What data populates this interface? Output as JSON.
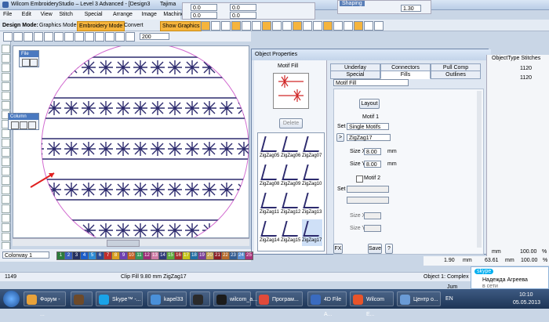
{
  "window_title": "Wilcom EmbroideryStudio – Level 3 Advanced - [Design3",
  "title_extra": "Tajima",
  "menu": [
    "File",
    "Edit",
    "View",
    "Stitch",
    "Special",
    "Arrange",
    "Image",
    "Machine",
    "Window"
  ],
  "toolbar": {
    "design_mode_label": "Design Mode:",
    "graphics_mode": "Graphics Mode",
    "embroidery_mode": "Embroidery Mode",
    "convert": "Convert",
    "show_graphics": "Show Graphics",
    "zoom_value": "200",
    "shaping_label": "Shaping",
    "value_130": "1.30",
    "coord_0a": "0.0",
    "coord_0b": "0.0",
    "coord_0c": "0.0",
    "coord_0d": "0.0"
  },
  "file_toolbar": {
    "title": "File"
  },
  "column_toolbar": {
    "title": "Column"
  },
  "colorway": {
    "label": "Colorway 1",
    "swatches": [
      "1",
      "2",
      "3",
      "4",
      "5",
      "6",
      "7",
      "8",
      "9",
      "10",
      "11",
      "12",
      "13",
      "14",
      "15",
      "16",
      "17",
      "18",
      "19",
      "20",
      "21",
      "22",
      "23",
      "24",
      "25"
    ],
    "colors": [
      "#2c7c3c",
      "#3a5fbf",
      "#25305f",
      "#1c5ec9",
      "#2d8cd6",
      "#2b4a92",
      "#c02d2d",
      "#d9a020",
      "#6f3fb2",
      "#c35f22",
      "#36965a",
      "#9d2b79",
      "#cf7aa6",
      "#2f3a7a",
      "#5caa39",
      "#a62d2d",
      "#c4c418",
      "#1f6fa5",
      "#7a3c98",
      "#c8a54e",
      "#8c1e26",
      "#b76a2a",
      "#345e94",
      "#5a8fd3",
      "#a8327a"
    ]
  },
  "dialog": {
    "title": "Object Properties",
    "tabs_row1": [
      "Underlay",
      "Connectors",
      "Pull Comp"
    ],
    "tabs_row2": [
      "Special",
      "Fills",
      "Outlines"
    ],
    "active_tab": "Fills",
    "fill_type": "Motif Fill",
    "preview_label": "Motif Fill",
    "delete": "Delete",
    "layout": "Layout",
    "motif1_label": "Motif 1",
    "set_label": "Set",
    "set_value": "Single Motifs",
    "motif_value": "ZigZag17",
    "size_x_label": "Size X",
    "size_x": "8.00",
    "size_y_label": "Size Y",
    "size_y": "8.00",
    "unit": "mm",
    "motif2_label": "Motif 2",
    "set2_label": "Set",
    "size_x2_label": "Size X",
    "size_y2_label": "Size Y",
    "fx": "FX",
    "save": "Save",
    "help": "?",
    "motifs": [
      "ZigZag05",
      "ZigZag06",
      "ZigZag07",
      "ZigZag08",
      "ZigZag09",
      "ZigZag10",
      "ZigZag11",
      "ZigZag12",
      "ZigZag13",
      "ZigZag14",
      "ZigZag15",
      "ZigZag17"
    ]
  },
  "right_panel": {
    "header": "ObjectType Stitches",
    "row1": "1120",
    "row2": "1120",
    "mm1": "mm",
    "pct1": "100.00",
    "pct1u": "%",
    "val_190": "1.90",
    "mm2": "mm",
    "val_6361": "63.61",
    "mm3": "mm",
    "pct2": "100.00",
    "pct2u": "%"
  },
  "status": {
    "stitches": "1149",
    "fill": "Clip Fill  9.80 mm ZigZag17",
    "object": "Object 1: Complex Fil"
  },
  "skype_popup": {
    "brand": "skype",
    "name": "Надежда Агреева",
    "sub": "в сети"
  },
  "taskbar": {
    "items": [
      "Форум - ...",
      "",
      "Skype™ -...",
      "kapel33",
      "",
      "wilcom_a...",
      "Програм...",
      "4D File A...",
      "Wilcom E...",
      "Центр о..."
    ],
    "lang": "EN",
    "time": "10:10",
    "date": "05.05.2013",
    "jum": "Jum"
  }
}
